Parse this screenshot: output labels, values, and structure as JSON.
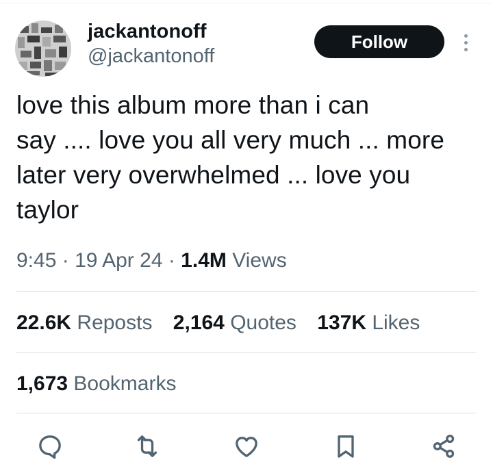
{
  "author": {
    "display_name": "jackantonoff",
    "handle": "@jackantonoff"
  },
  "follow_label": "Follow",
  "tweet": {
    "text": "love this album more than i can\nsay .... love you all very much ... more\nlater very overwhelmed ... love you\ntaylor"
  },
  "meta": {
    "time": "9:45",
    "separator1": " · ",
    "date": "19 Apr 24",
    "separator2": " · ",
    "views_count": "1.4M",
    "views_label": " Views"
  },
  "stats": {
    "reposts_count": "22.6K",
    "reposts_label": " Reposts",
    "quotes_count": "2,164",
    "quotes_label": " Quotes",
    "likes_count": "137K",
    "likes_label": " Likes",
    "bookmarks_count": "1,673",
    "bookmarks_label": " Bookmarks"
  },
  "icons": {
    "reply": "reply-icon",
    "repost": "repost-icon",
    "like": "like-icon",
    "bookmark": "bookmark-icon",
    "share": "share-icon",
    "more": "more-dots-icon"
  },
  "colors": {
    "text": "#0f1419",
    "secondary": "#536471",
    "follow_bg": "#0f1419",
    "icon": "#536471"
  }
}
